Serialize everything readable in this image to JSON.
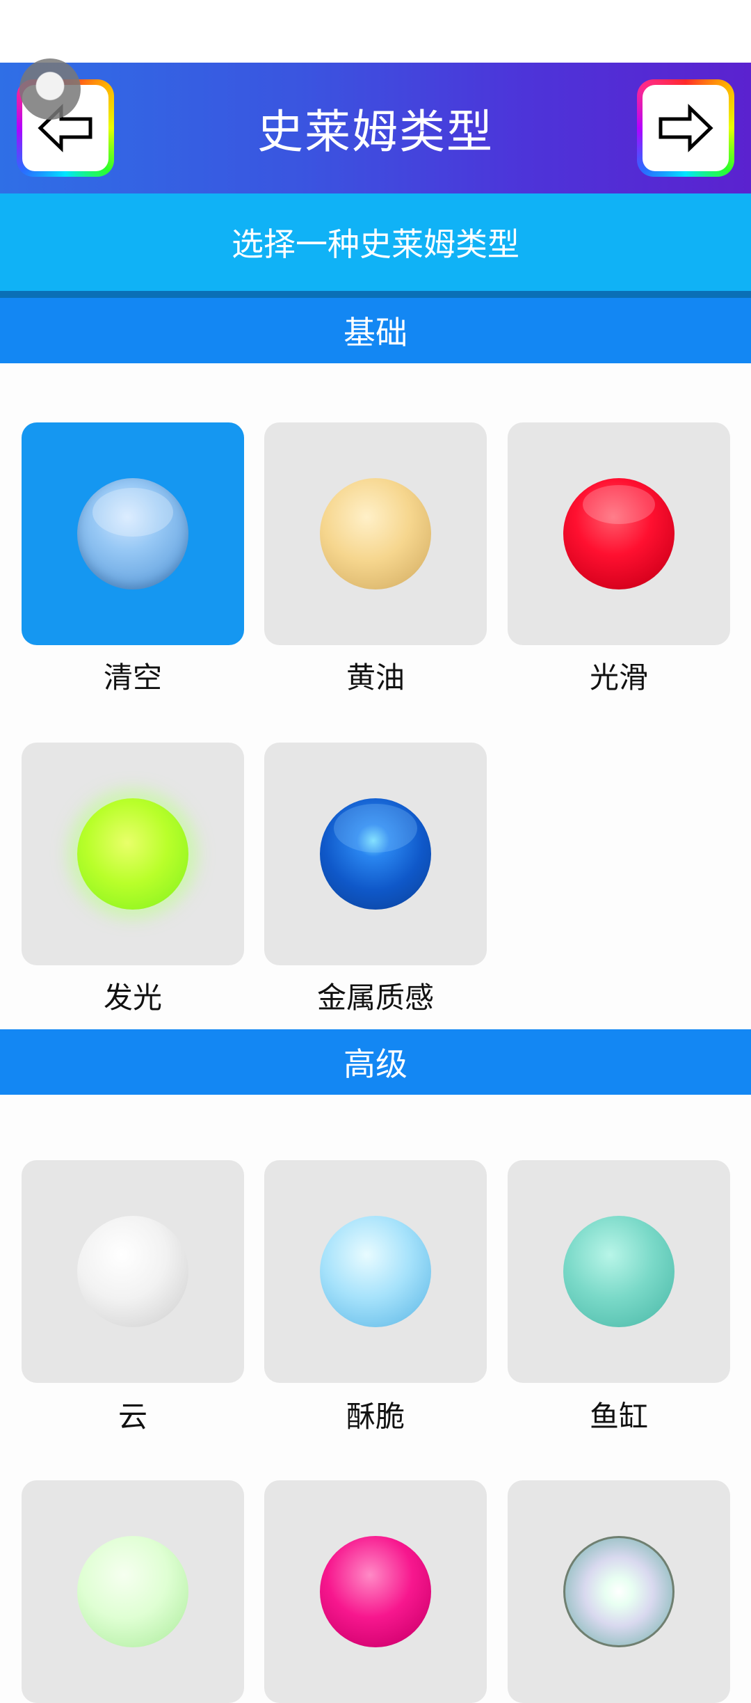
{
  "header": {
    "title": "史莱姆类型",
    "back_icon": "arrow-left-icon",
    "next_icon": "arrow-right-icon"
  },
  "subtitle": "选择一种史莱姆类型",
  "sections": {
    "basic": {
      "title": "基础",
      "items": [
        {
          "label": "清空",
          "selected": true,
          "color": "#7fb7ea"
        },
        {
          "label": "黄油",
          "selected": false,
          "color": "#f4d48c"
        },
        {
          "label": "光滑",
          "selected": false,
          "color": "#ff1030"
        },
        {
          "label": "发光",
          "selected": false,
          "color": "#b9ff2a"
        },
        {
          "label": "金属质感",
          "selected": false,
          "color": "#1360d0"
        }
      ]
    },
    "advanced": {
      "title": "高级",
      "items": [
        {
          "label": "云",
          "selected": false,
          "color": "#f2f2f2"
        },
        {
          "label": "酥脆",
          "selected": false,
          "color": "#a6e2fb"
        },
        {
          "label": "鱼缸",
          "selected": false,
          "color": "#7ad9c8"
        },
        {
          "label": "",
          "selected": false,
          "color": "#dfffd3"
        },
        {
          "label": "",
          "selected": false,
          "color": "#f7178e"
        },
        {
          "label": "",
          "selected": false,
          "color": "#d9d9ef"
        }
      ]
    }
  },
  "colors": {
    "header_start": "#2f6fe6",
    "header_end": "#5b22cf",
    "subtitle_band": "#10b2f6",
    "section_bar": "#1387f3",
    "selected_tile": "#1597f1",
    "tile": "#e6e6e6"
  }
}
